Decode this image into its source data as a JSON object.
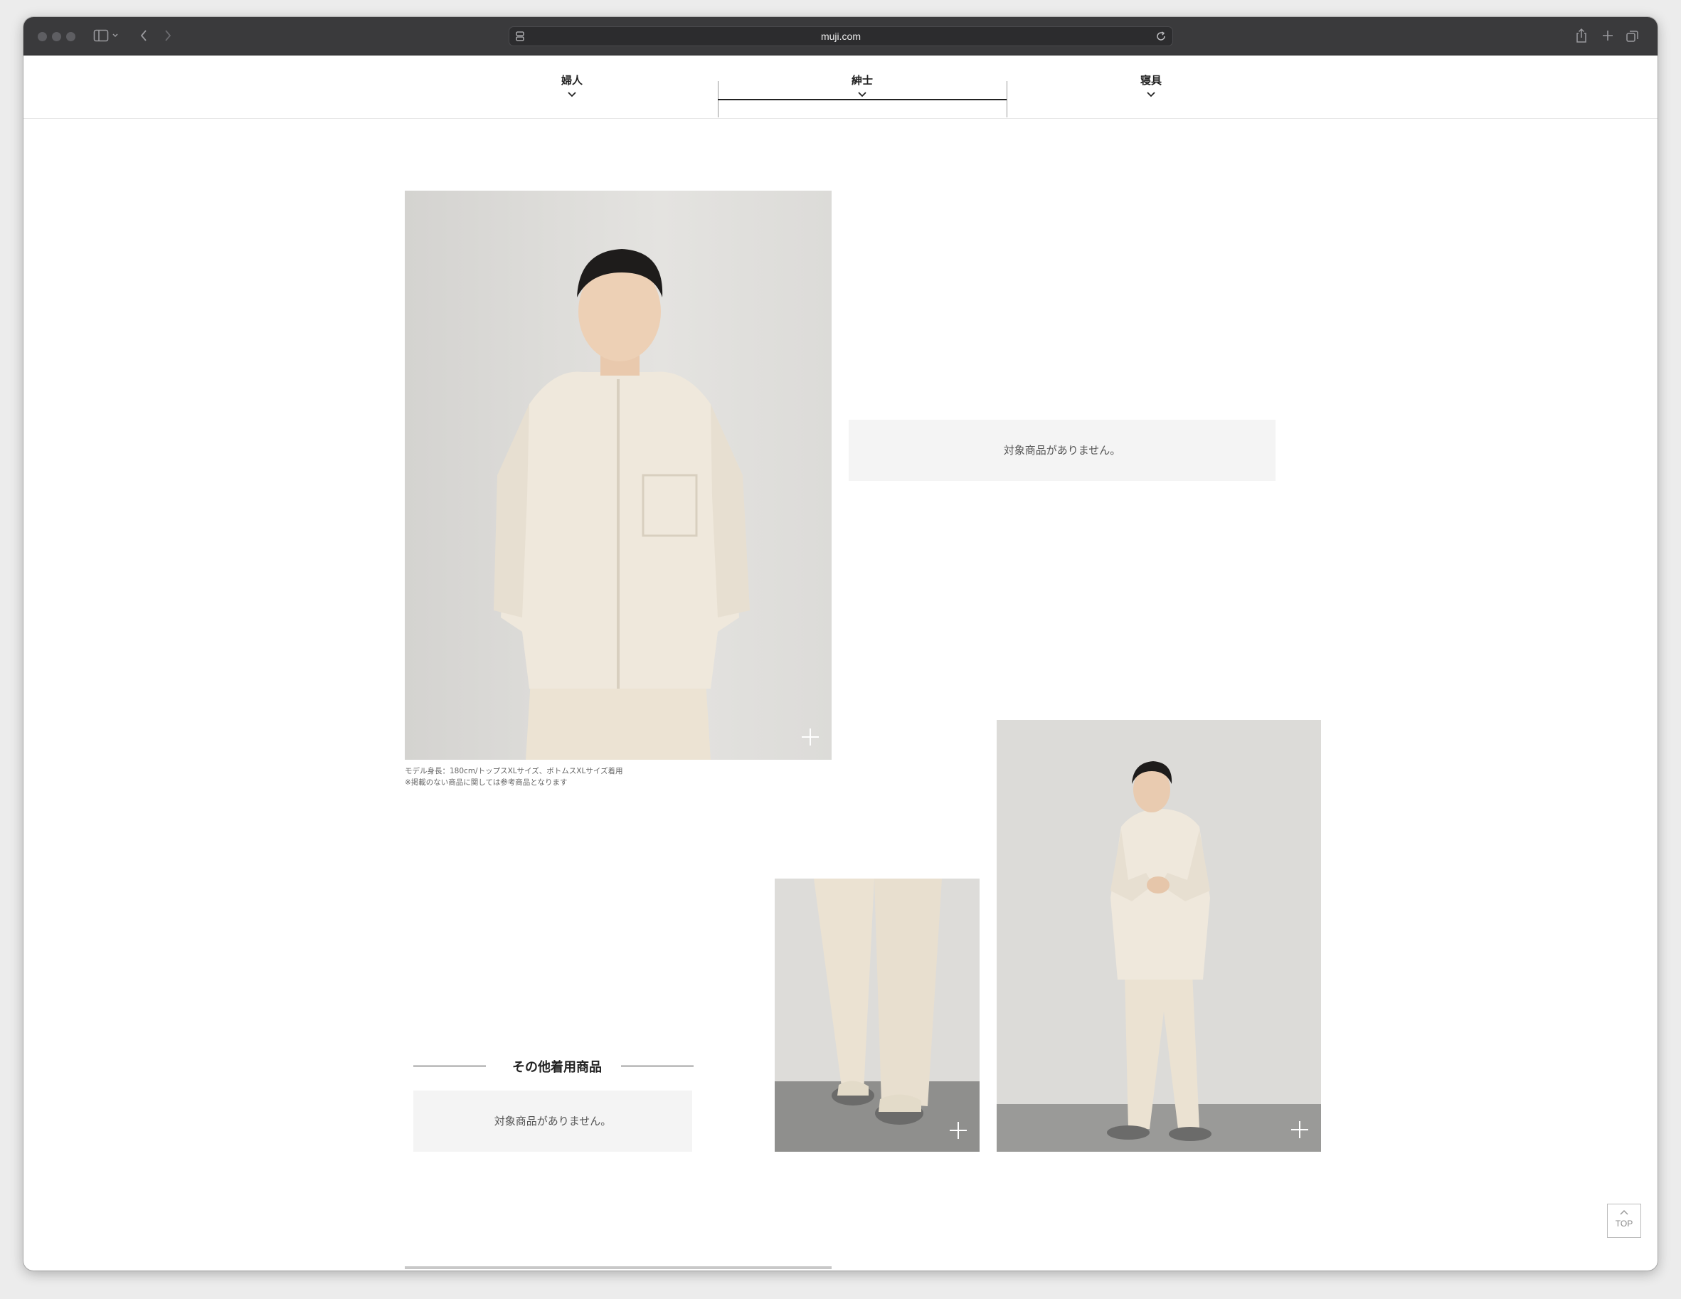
{
  "browser": {
    "url": "muji.com"
  },
  "category_nav": {
    "tabs": [
      {
        "label": "婦人",
        "active": false
      },
      {
        "label": "紳士",
        "active": true
      },
      {
        "label": "寝具",
        "active": false
      }
    ]
  },
  "main_look": {
    "caption_line1": "モデル身長：180cm/トップスXLサイズ、ボトムスXLサイズ着用",
    "caption_line2": "※掲載のない商品に関しては参考商品となります",
    "no_items_text": "対象商品がありません。"
  },
  "other_items": {
    "title": "その他着用商品",
    "no_items_text": "対象商品がありません。"
  },
  "back_to_top": {
    "label": "TOP"
  },
  "colors": {
    "chrome": "#3a3a3c",
    "empty_box": "#f4f4f4",
    "text_dark": "#222222"
  }
}
